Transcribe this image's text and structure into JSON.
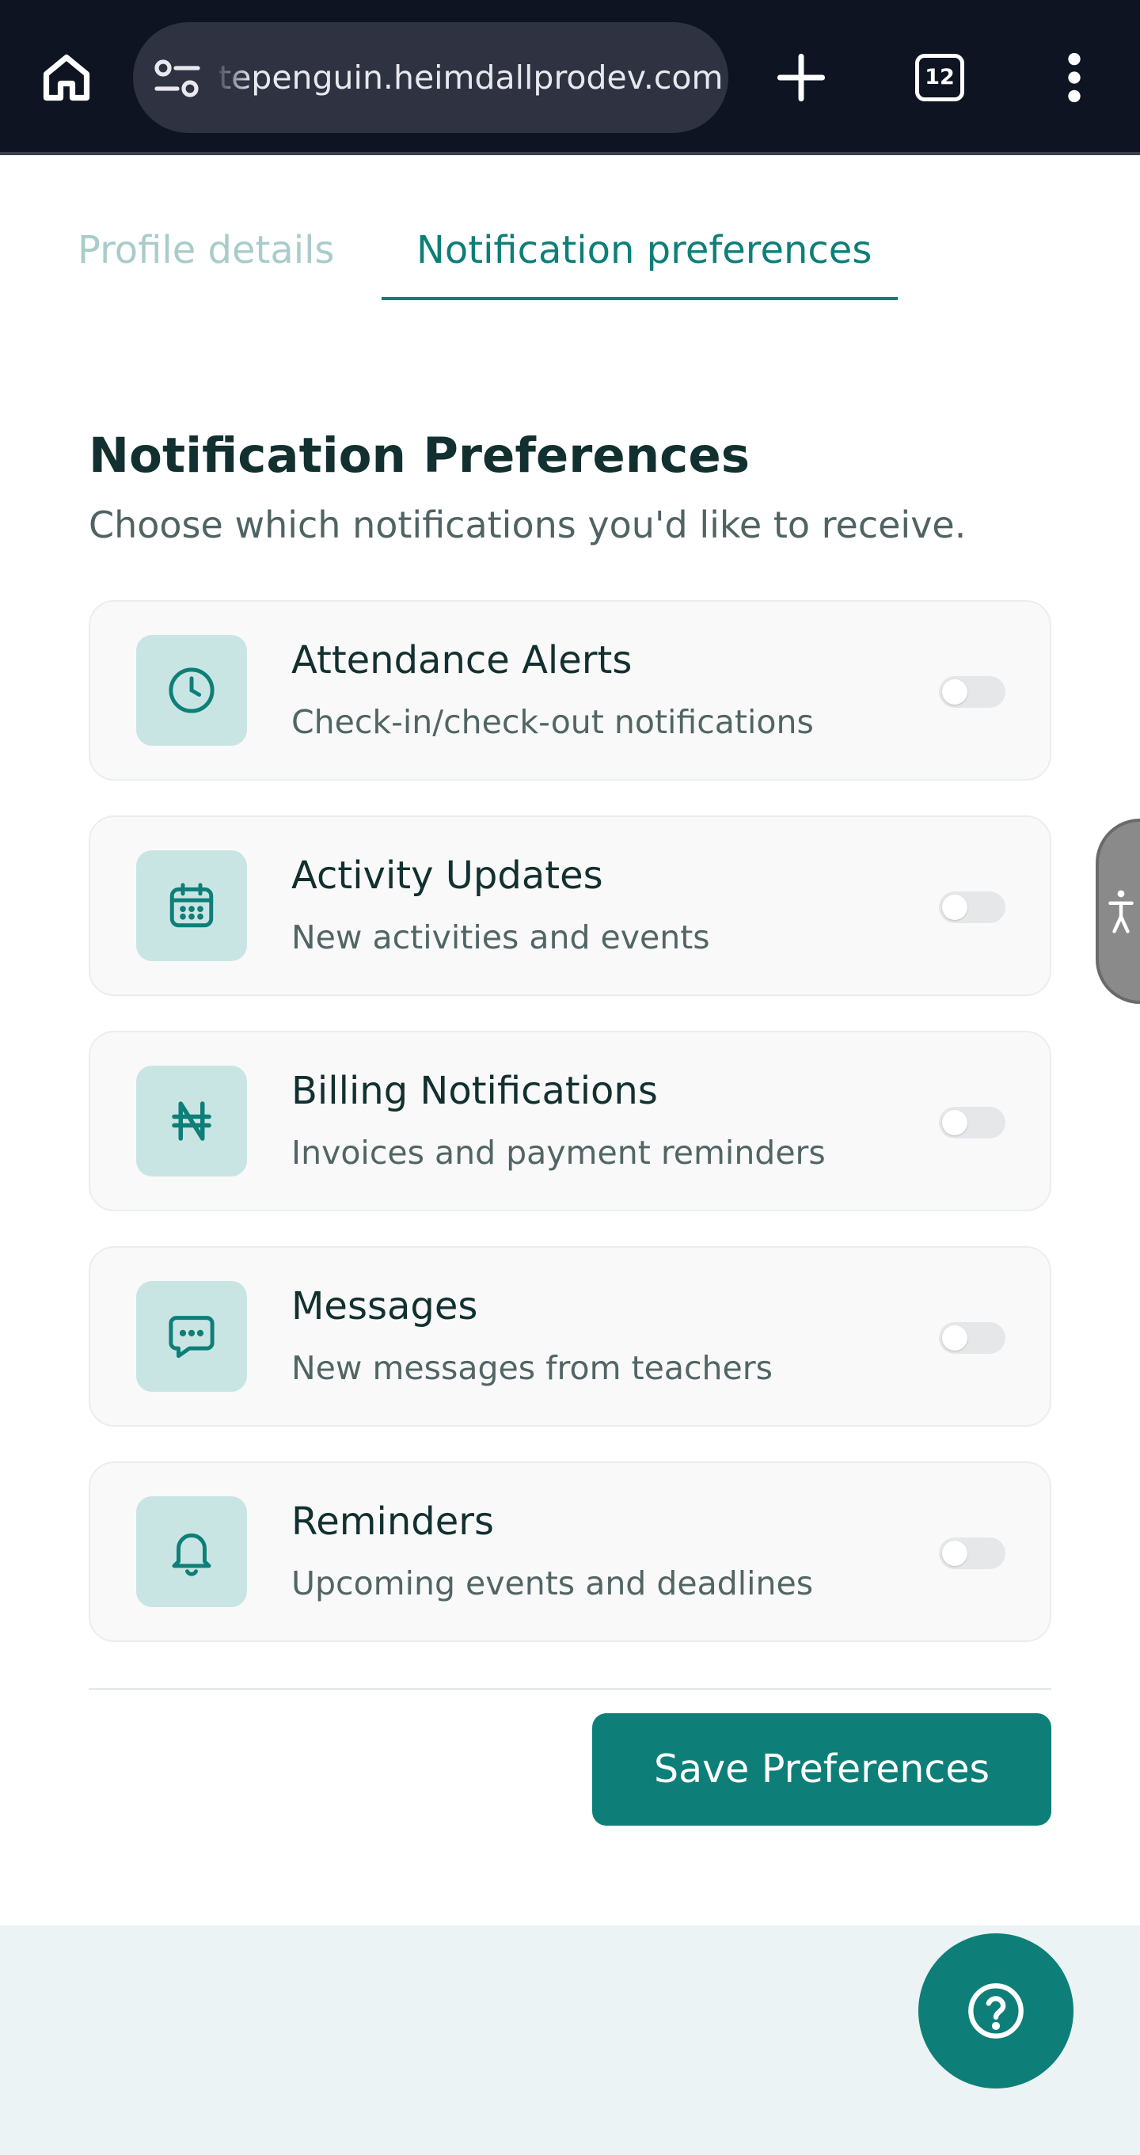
{
  "browser": {
    "url": "tepenguin.heimdallprodev.com",
    "tab_count": "12",
    "icons": [
      "home-icon",
      "site-controls-icon",
      "plus-icon",
      "tab-switcher-icon",
      "more-vert-icon"
    ]
  },
  "tabs": [
    {
      "label": "Profile details",
      "active": false
    },
    {
      "label": "Notification preferences",
      "active": true
    }
  ],
  "page": {
    "title": "Notification Preferences",
    "subtitle": "Choose which notifications you'd like to receive."
  },
  "preferences": [
    {
      "title": "Attendance Alerts",
      "description": "Check-in/check-out notifications",
      "icon": "clock-icon",
      "enabled": false
    },
    {
      "title": "Activity Updates",
      "description": "New activities and events",
      "icon": "calendar-icon",
      "enabled": false
    },
    {
      "title": "Billing Notifications",
      "description": "Invoices and payment reminders",
      "icon": "naira-icon",
      "enabled": false
    },
    {
      "title": "Messages",
      "description": "New messages from teachers",
      "icon": "message-icon",
      "enabled": false
    },
    {
      "title": "Reminders",
      "description": "Upcoming events and deadlines",
      "icon": "bell-icon",
      "enabled": false
    }
  ],
  "actions": {
    "save_label": "Save Preferences"
  },
  "colors": {
    "accent": "#0d7f78",
    "icon_tile": "#c9e5e3",
    "chrome_bg": "#0f1423",
    "toggle_off": "#e5e7e9"
  }
}
